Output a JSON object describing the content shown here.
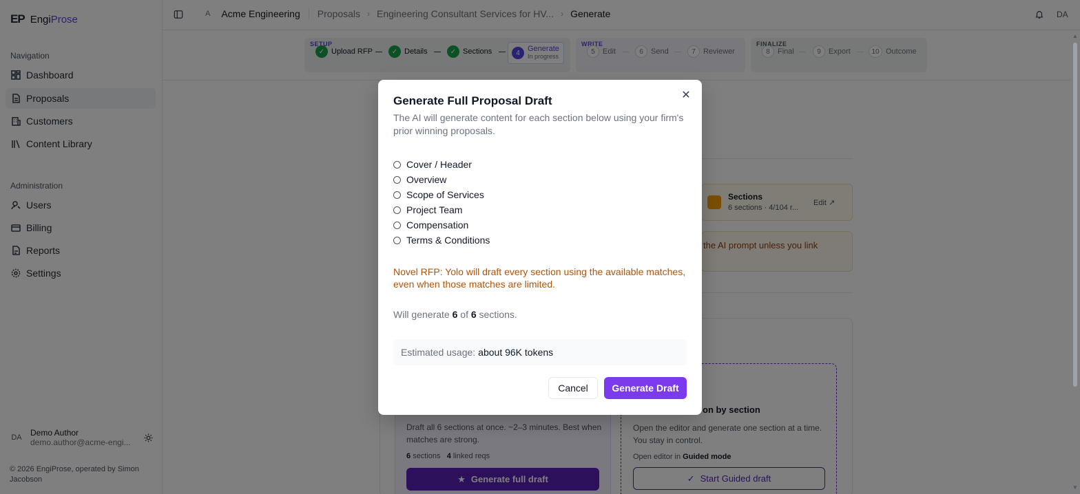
{
  "app": {
    "logo_mark": "EP",
    "name_part1": "Engi",
    "name_part2": "Prose"
  },
  "sidebar": {
    "nav_heading": "Navigation",
    "nav_items": [
      {
        "label": "Dashboard",
        "icon": "grid-icon"
      },
      {
        "label": "Proposals",
        "icon": "file-icon",
        "active": true
      },
      {
        "label": "Customers",
        "icon": "building-icon"
      },
      {
        "label": "Content Library",
        "icon": "library-icon"
      }
    ],
    "admin_heading": "Administration",
    "admin_items": [
      {
        "label": "Users",
        "icon": "user-icon"
      },
      {
        "label": "Billing",
        "icon": "card-icon"
      },
      {
        "label": "Reports",
        "icon": "doc-icon"
      },
      {
        "label": "Settings",
        "icon": "gear-icon"
      }
    ],
    "user": {
      "initials": "DA",
      "name": "Demo Author",
      "email": "demo.author@acme-engi..."
    },
    "footer": "© 2026 EngiProse, operated by Simon Jacobson"
  },
  "topbar": {
    "org_badge": "A",
    "breadcrumbs": [
      "Acme Engineering",
      "Proposals",
      "Engineering Consultant Services for HV...",
      "Generate"
    ],
    "avatar": "DA"
  },
  "stepper": {
    "setup_label": "SETUP",
    "write_label": "WRITE",
    "finalize_label": "FINALIZE",
    "steps": [
      {
        "label": "Upload RFP"
      },
      {
        "label": "Details"
      },
      {
        "label": "Sections"
      },
      {
        "num": "4",
        "label": "Generate",
        "sub": "In progress"
      },
      {
        "num": "5",
        "label": "Edit"
      },
      {
        "num": "6",
        "label": "Send"
      },
      {
        "num": "7",
        "label": "Reviewer"
      },
      {
        "num": "8",
        "label": "Final"
      },
      {
        "num": "9",
        "label": "Export"
      },
      {
        "num": "10",
        "label": "Outcome"
      }
    ]
  },
  "background": {
    "sections_card": {
      "title": "Sections",
      "sub": "6 sections · 4/104 r...",
      "edit": "Edit"
    },
    "warning_fragment": "the AI prompt unless you link",
    "full_draft": {
      "desc": "Draft all 6 sections at once. ~2–3 minutes. Best when matches are strong.",
      "sections_count": "6",
      "sections_word": "sections",
      "reqs_count": "4",
      "reqs_word": "linked reqs",
      "button": "Generate full draft"
    },
    "guided": {
      "title_fragment": "on by section",
      "desc": "Open the editor and generate one section at a time. You stay in control.",
      "meta_prefix": "Open editor in",
      "meta_mode": "Guided mode",
      "button": "Start Guided draft"
    }
  },
  "modal": {
    "title": "Generate Full Proposal Draft",
    "description": "The AI will generate content for each section below using your firm's prior winning proposals.",
    "sections": [
      "Cover / Header",
      "Overview",
      "Scope of Services",
      "Project Team",
      "Compensation",
      "Terms & Conditions"
    ],
    "novel_note": "Novel RFP: Yolo will draft every section using the available matches, even when those matches are limited.",
    "will_prefix": "Will generate",
    "will_count": "6",
    "will_of": "of",
    "will_total": "6",
    "will_suffix": "sections.",
    "usage_label": "Estimated usage:",
    "usage_value": "about 96K tokens",
    "cancel": "Cancel",
    "generate": "Generate Draft"
  },
  "colors": {
    "primary": "#7c3aed",
    "success": "#16a34a",
    "warning": "#b45309"
  }
}
